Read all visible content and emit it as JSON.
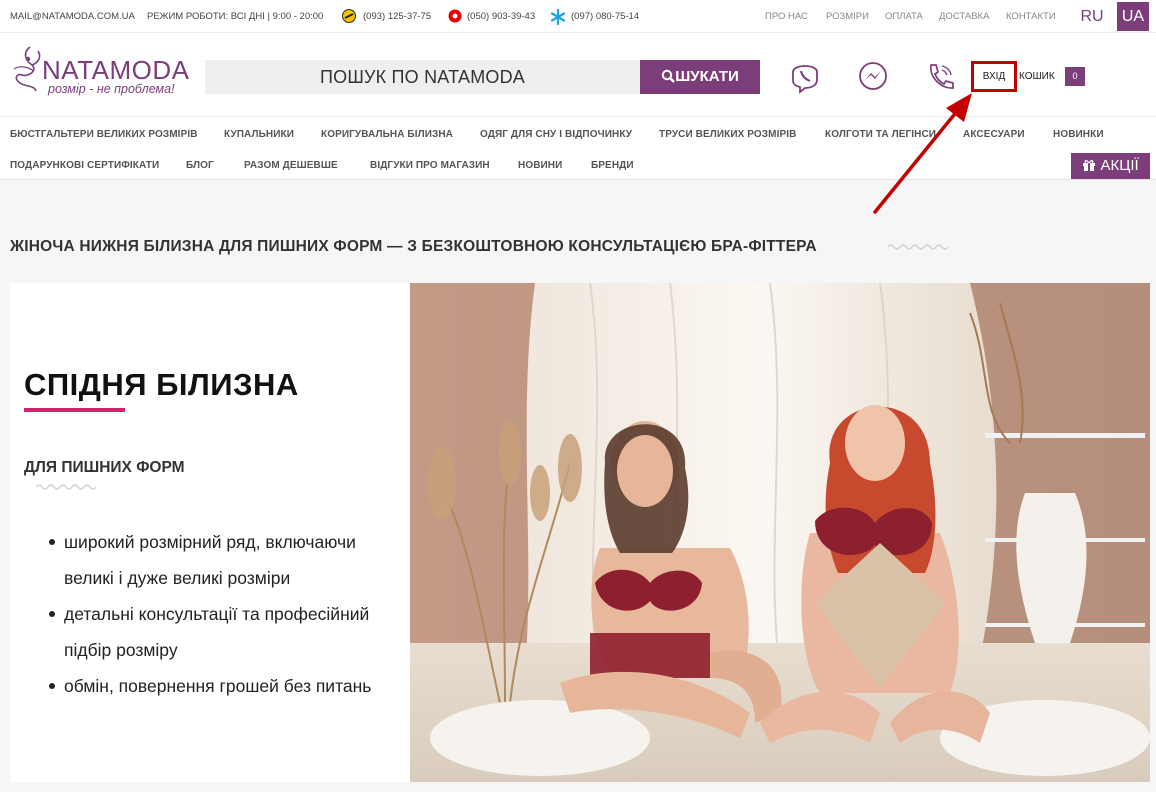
{
  "topbar": {
    "email": "MAIL@NATAMODA.COM.UA",
    "hours": "РЕЖИМ РОБОТИ: ВСІ ДНІ | 9:00 - 20:00",
    "phones": [
      "(093) 125-37-75",
      "(050) 903-39-43",
      "(097) 080-75-14"
    ],
    "links": [
      "ПРО НАС",
      "РОЗМІРИ",
      "ОПЛАТА",
      "ДОСТАВКА",
      "КОНТАКТИ"
    ],
    "lang_ru": "RU",
    "lang_ua": "UA"
  },
  "header": {
    "logo_text": "NATAMODA",
    "logo_tagline": "розмір - не проблема!",
    "search_placeholder": "ПОШУК ПО NATAMODA",
    "search_button": "ШУКАТИ",
    "login": "ВХІД",
    "cart": "КОШИК",
    "cart_count": "0"
  },
  "nav": {
    "row1": [
      "БЮСТГАЛЬТЕРИ ВЕЛИКИХ РОЗМІРІВ",
      "КУПАЛЬНИКИ",
      "КОРИГУВАЛЬНА БІЛИЗНА",
      "ОДЯГ ДЛЯ СНУ І ВІДПОЧИНКУ",
      "ТРУСИ ВЕЛИКИХ РОЗМІРІВ",
      "КОЛГОТИ ТА ЛЕГІНСИ",
      "АКСЕСУАРИ",
      "НОВИНКИ"
    ],
    "row2": [
      "ПОДАРУНКОВІ СЕРТИФІКАТИ",
      "БЛОГ",
      "РАЗОМ ДЕШЕВШЕ",
      "ВІДГУКИ ПРО МАГАЗИН",
      "НОВИНИ",
      "БРЕНДИ"
    ],
    "promo": "АКЦІЇ"
  },
  "main": {
    "headline": "ЖІНОЧА НИЖНЯ БІЛИЗНА ДЛЯ ПИШНИХ ФОРМ — З БЕЗКОШТОВНОЮ КОНСУЛЬТАЦІЄЮ БРА-ФІТТЕРА",
    "title": "СПІДНЯ БІЛИЗНА",
    "subtitle": "ДЛЯ ПИШНИХ ФОРМ",
    "bullets": [
      "широкий розмірний ряд, включаючи великі і дуже великі розміри",
      "детальні консультації та професійний підбір розміру",
      "обмін, повернення грошей без питань"
    ]
  },
  "colors": {
    "brand": "#7b3e7a",
    "accent": "#d4236a",
    "highlight": "#c40000"
  }
}
